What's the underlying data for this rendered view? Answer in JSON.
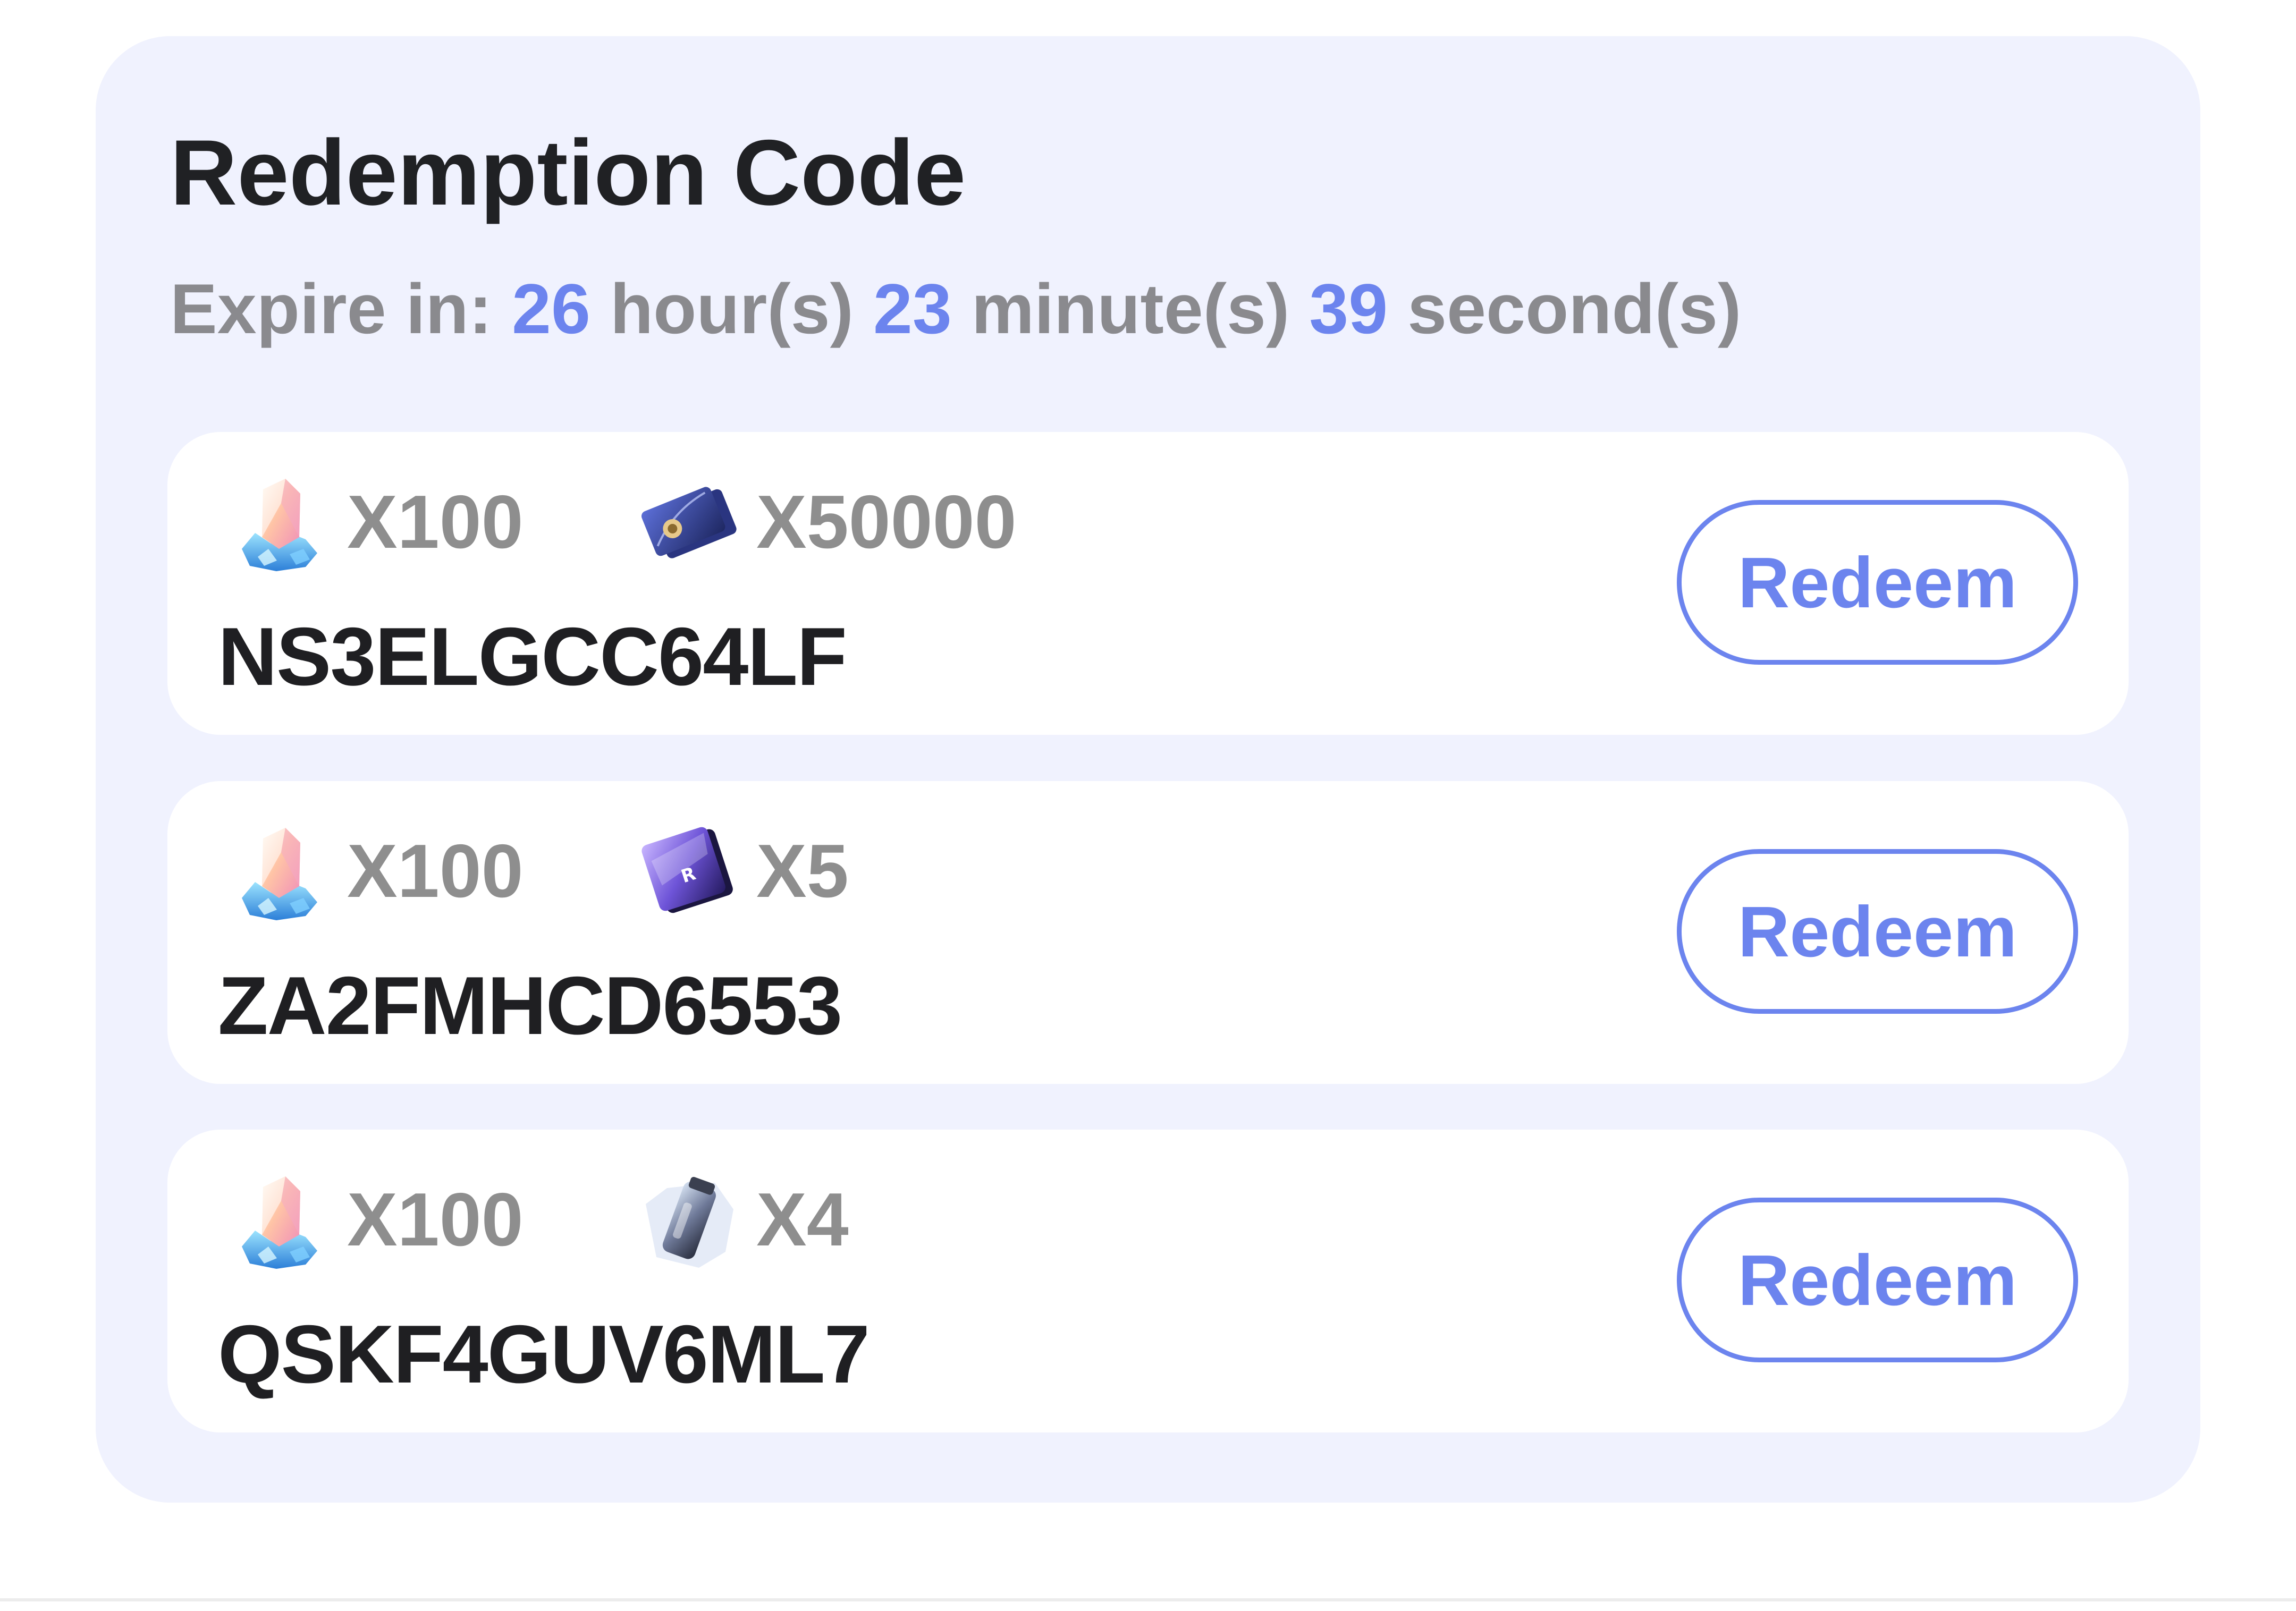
{
  "title": "Redemption Code",
  "expire": {
    "prefix": "Expire in:",
    "hours": "26",
    "hours_unit": "hour(s)",
    "minutes": "23",
    "minutes_unit": "minute(s)",
    "seconds": "39",
    "seconds_unit": "second(s)"
  },
  "codes": [
    {
      "code": "NS3ELGCC64LF",
      "rewards": [
        {
          "icon": "crystal-icon",
          "qty": "X100"
        },
        {
          "icon": "credit-card-icon",
          "qty": "X50000"
        }
      ],
      "button_label": "Redeem"
    },
    {
      "code": "ZA2FMHCD6553",
      "rewards": [
        {
          "icon": "crystal-icon",
          "qty": "X100"
        },
        {
          "icon": "ticket-pass-icon",
          "qty": "X5"
        }
      ],
      "button_label": "Redeem"
    },
    {
      "code": "QSKF4GUV6ML7",
      "rewards": [
        {
          "icon": "crystal-icon",
          "qty": "X100"
        },
        {
          "icon": "material-canister-icon",
          "qty": "X4"
        }
      ],
      "button_label": "Redeem"
    }
  ],
  "colors": {
    "accent": "#6c84ee",
    "panel_background": "#f0f2fe",
    "card_background": "#ffffff",
    "muted_text": "#8a8a8e",
    "code_text": "#1f1f22"
  }
}
